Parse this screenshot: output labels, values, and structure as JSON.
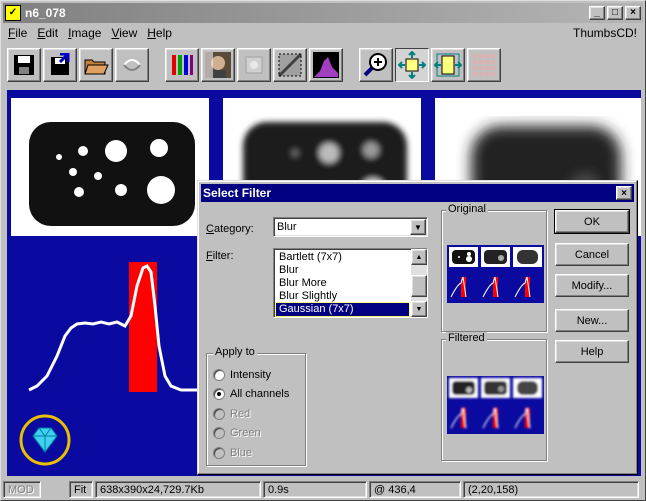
{
  "window": {
    "title": "n6_078",
    "app_icon_glyph": "✓",
    "minimize_glyph": "_",
    "maximize_glyph": "□",
    "close_glyph": "×"
  },
  "menu": {
    "items": [
      {
        "label": "File",
        "ul": "F",
        "rest": "ile"
      },
      {
        "label": "Edit",
        "ul": "E",
        "rest": "dit"
      },
      {
        "label": "Image",
        "ul": "I",
        "rest": "mage"
      },
      {
        "label": "View",
        "ul": "V",
        "rest": "iew"
      },
      {
        "label": "Help",
        "ul": "H",
        "rest": "elp"
      }
    ],
    "right_label": "ThumbsCD!"
  },
  "toolbar": {
    "icons": [
      "save-icon",
      "save-as-icon",
      "open-folder-icon",
      "revert-icon",
      "color-pencils-icon",
      "portrait-icon",
      "disabled-tool-icon",
      "select-region-icon",
      "histogram-icon",
      "zoom-in-icon",
      "fit-window-icon",
      "fit-width-icon",
      "thumbnail-grid-icon"
    ]
  },
  "statusbar": {
    "mode": "MOD",
    "fit": "Fit",
    "image_info": "638x390x24,729.7Kb",
    "time": "0.9s",
    "coords": "@ 436,4",
    "pixel": "(2,20,158)"
  },
  "dialog": {
    "title": "Select Filter",
    "close_glyph": "×",
    "category_label": "Category:",
    "category_ul": "C",
    "category_value": "Blur",
    "filter_label": "Filter:",
    "filter_ul": "F",
    "filters": [
      "Bartlett (7x7)",
      "Blur",
      "Blur More",
      "Blur Slightly",
      "Gaussian (7x7)"
    ],
    "selected_filter": "Gaussian (7x7)",
    "apply_to_label": "Apply to",
    "apply_options": [
      {
        "label": "Intensity",
        "checked": false,
        "enabled": true
      },
      {
        "label": "All channels",
        "checked": true,
        "enabled": true
      },
      {
        "label": "Red",
        "checked": false,
        "enabled": false
      },
      {
        "label": "Green",
        "checked": false,
        "enabled": false
      },
      {
        "label": "Blue",
        "checked": false,
        "enabled": false
      }
    ],
    "original_label": "Original",
    "filtered_label": "Filtered",
    "buttons": {
      "ok": "OK",
      "cancel": "Cancel",
      "modify": "Modify...",
      "new": "New...",
      "help": "Help"
    }
  },
  "colors": {
    "canvas_bg": "#0a0aa0",
    "highlight": "#000080",
    "red_bar": "#ff0000"
  }
}
